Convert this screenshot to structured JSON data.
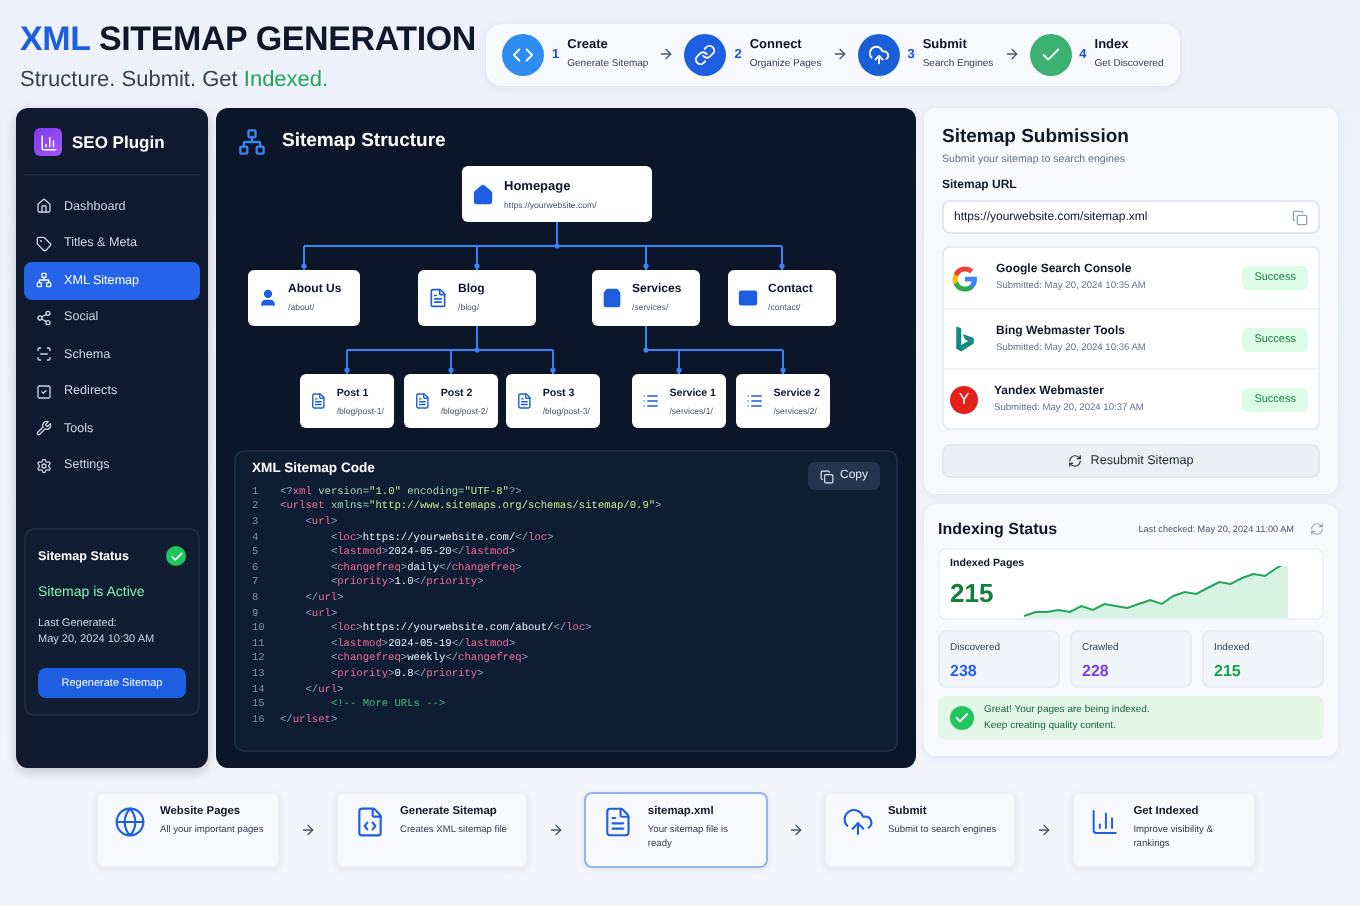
{
  "header": {
    "title": {
      "accent": "XML",
      "rest": "SITEMAP GENERATION"
    },
    "tagline": {
      "text": "Structure. Submit. Get",
      "accent": "Indexed."
    }
  },
  "steps": [
    {
      "number": "1",
      "title": "Create",
      "subtitle": "Generate Sitemap",
      "color": "#2f8cf0"
    },
    {
      "number": "2",
      "title": "Connect",
      "subtitle": "Organize Pages",
      "color": "#1d5fe0"
    },
    {
      "number": "3",
      "title": "Submit",
      "subtitle": "Search Engines",
      "color": "#1b5fd8"
    },
    {
      "number": "4",
      "title": "Index",
      "subtitle": "Get Discovered",
      "color": "#3bb273"
    }
  ],
  "sidebar": {
    "brand": "SEO Plugin",
    "items": [
      {
        "label": "Dashboard",
        "selected": false
      },
      {
        "label": "Titles & Meta",
        "selected": false
      },
      {
        "label": "XML Sitemap",
        "selected": true
      },
      {
        "label": "Social",
        "selected": false
      },
      {
        "label": "Schema",
        "selected": false
      },
      {
        "label": "Redirects",
        "selected": false
      },
      {
        "label": "Tools",
        "selected": false
      },
      {
        "label": "Settings",
        "selected": false
      }
    ],
    "status": {
      "title": "Sitemap Status",
      "state": "Sitemap is Active",
      "generated_label": "Last Generated:",
      "generated_at": "May 20, 2024 10:30 AM",
      "button": "Regenerate Sitemap"
    }
  },
  "structure": {
    "title": "Sitemap Structure",
    "tree": {
      "title": "Homepage",
      "path": "https://yourwebsite.com/",
      "children": [
        {
          "title": "About Us",
          "path": "/about/"
        },
        {
          "title": "Blog",
          "path": "/blog/",
          "children": [
            {
              "title": "Post 1",
              "path": "/blog/post-1/"
            },
            {
              "title": "Post 2",
              "path": "/blog/post-2/"
            },
            {
              "title": "Post 3",
              "path": "/blog/post-3/"
            }
          ]
        },
        {
          "title": "Services",
          "path": "/services/",
          "children": [
            {
              "title": "Service 1",
              "path": "/services/1/"
            },
            {
              "title": "Service 2",
              "path": "/services/2/"
            }
          ]
        },
        {
          "title": "Contact",
          "path": "/contact/"
        }
      ]
    }
  },
  "code": {
    "title": "XML Sitemap Code",
    "copy_button": "Copy",
    "lines": [
      {
        "number": "1",
        "text": "<?xml version=\"1.0\" encoding=\"UTF-8\"?>"
      },
      {
        "number": "2",
        "text": "<urlset xmlns=\"http://www.sitemaps.org/schemas/sitemap/0.9\">"
      },
      {
        "number": "3",
        "text": "    <url>"
      },
      {
        "number": "4",
        "text": "        <loc>https://yourwebsite.com/</loc>"
      },
      {
        "number": "5",
        "text": "        <lastmod>2024-05-20</lastmod>"
      },
      {
        "number": "6",
        "text": "        <changefreq>daily</changefreq>"
      },
      {
        "number": "7",
        "text": "        <priority>1.0</priority>"
      },
      {
        "number": "8",
        "text": "    </url>"
      },
      {
        "number": "9",
        "text": "    <url>"
      },
      {
        "number": "10",
        "text": "        <loc>https://yourwebsite.com/about/</loc>"
      },
      {
        "number": "11",
        "text": "        <lastmod>2024-05-19</lastmod>"
      },
      {
        "number": "12",
        "text": "        <changefreq>weekly</changefreq>"
      },
      {
        "number": "13",
        "text": "        <priority>0.8</priority>"
      },
      {
        "number": "14",
        "text": "    </url>"
      },
      {
        "number": "15",
        "text": "        <!-- More URLs -->"
      },
      {
        "number": "16",
        "text": "</urlset>"
      }
    ]
  },
  "submission": {
    "title": "Sitemap Submission",
    "subtitle": "Submit your sitemap to search engines",
    "url_label": "Sitemap URL",
    "url": "https://yourwebsite.com/sitemap.xml",
    "engines": [
      {
        "kind": "google",
        "name": "Google Search Console",
        "submitted": "Submitted: May 20, 2024 10:35 AM",
        "status": "Success"
      },
      {
        "kind": "bing",
        "name": "Bing Webmaster Tools",
        "submitted": "Submitted: May 20, 2024 10:36 AM",
        "status": "Success"
      },
      {
        "kind": "yandex",
        "name": "Yandex Webmaster",
        "logo_text": "Y",
        "submitted": "Submitted: May 20, 2024 10:37 AM",
        "status": "Success"
      }
    ],
    "button": "Resubmit Sitemap"
  },
  "indexing": {
    "title": "Indexing Status",
    "last_checked": "Last checked: May 20, 2024 11:00 AM",
    "indexed_label": "Indexed Pages",
    "indexed_value": "215",
    "stats": [
      {
        "label": "Discovered",
        "value": "238",
        "color": "#2563eb"
      },
      {
        "label": "Crawled",
        "value": "228",
        "color": "#7c3aed"
      },
      {
        "label": "Indexed",
        "value": "215",
        "color": "#16a34a"
      }
    ],
    "message": {
      "title": "Great! Your pages are being indexed.",
      "text": "Keep creating quality content."
    }
  },
  "flow": [
    {
      "title": "Website Pages",
      "text": "All your important pages",
      "selected": false
    },
    {
      "title": "Generate Sitemap",
      "text": "Creates XML sitemap file",
      "selected": false
    },
    {
      "title": "sitemap.xml",
      "text": "Your sitemap file is ready",
      "selected": true
    },
    {
      "title": "Submit",
      "text": "Submit to search engines",
      "selected": false
    },
    {
      "title": "Get Indexed",
      "text": "Improve visibility & rankings",
      "selected": false
    }
  ]
}
